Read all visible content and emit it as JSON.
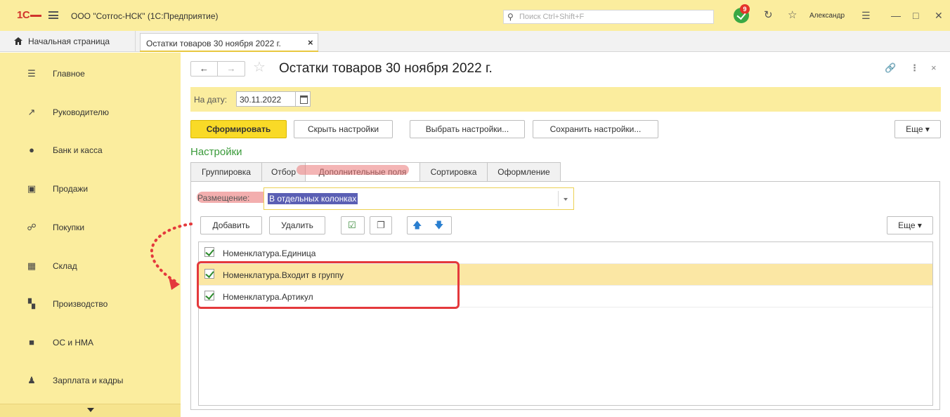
{
  "titlebar": {
    "logo": "1С",
    "app_title": "ООО \"Сотгос-НСК\"  (1С:Предприятие)",
    "search_placeholder": "Поиск Ctrl+Shift+F",
    "notification_count": "9",
    "user_name": "Александр"
  },
  "tabs_bar": {
    "home_label": "Начальная страница",
    "doc_tab_label": "Остатки товаров 30 ноября 2022 г."
  },
  "sidebar": {
    "items": [
      {
        "label": "Главное",
        "icon": "hamburger-icon"
      },
      {
        "label": "Руководителю",
        "icon": "trend-icon"
      },
      {
        "label": "Банк и касса",
        "icon": "coin-icon"
      },
      {
        "label": "Продажи",
        "icon": "bag-icon"
      },
      {
        "label": "Покупки",
        "icon": "cart-icon"
      },
      {
        "label": "Склад",
        "icon": "warehouse-icon"
      },
      {
        "label": "Производство",
        "icon": "factory-icon"
      },
      {
        "label": "ОС и НМА",
        "icon": "truck-icon"
      },
      {
        "label": "Зарплата и кадры",
        "icon": "person-icon"
      }
    ]
  },
  "main": {
    "title": "Остатки товаров 30 ноября 2022 г.",
    "date_label": "На дату:",
    "date_value": "30.11.2022",
    "buttons": {
      "generate": "Сформировать",
      "hide_settings": "Скрыть настройки",
      "choose_settings": "Выбрать настройки...",
      "save_settings": "Сохранить настройки...",
      "more": "Еще"
    },
    "settings_title": "Настройки",
    "tabs": [
      "Группировка",
      "Отбор",
      "Дополнительные поля",
      "Сортировка",
      "Оформление"
    ],
    "active_tab": "Дополнительные поля",
    "placement_label": "Размещение:",
    "placement_value": "В отдельных колонках",
    "list_buttons": {
      "add": "Добавить",
      "delete": "Удалить",
      "more": "Еще"
    },
    "fields": [
      {
        "label": "Номенклатура.Единица",
        "checked": true,
        "selected": false
      },
      {
        "label": "Номенклатура.Входит в группу",
        "checked": true,
        "selected": true
      },
      {
        "label": "Номенклатура.Артикул",
        "checked": true,
        "selected": false
      }
    ]
  },
  "colors": {
    "accent_yellow": "#fbed9e",
    "primary_button": "#f9da27",
    "settings_green": "#3a9a3a",
    "annotation_red": "#e4393c",
    "selection": "#fbe7a4"
  }
}
